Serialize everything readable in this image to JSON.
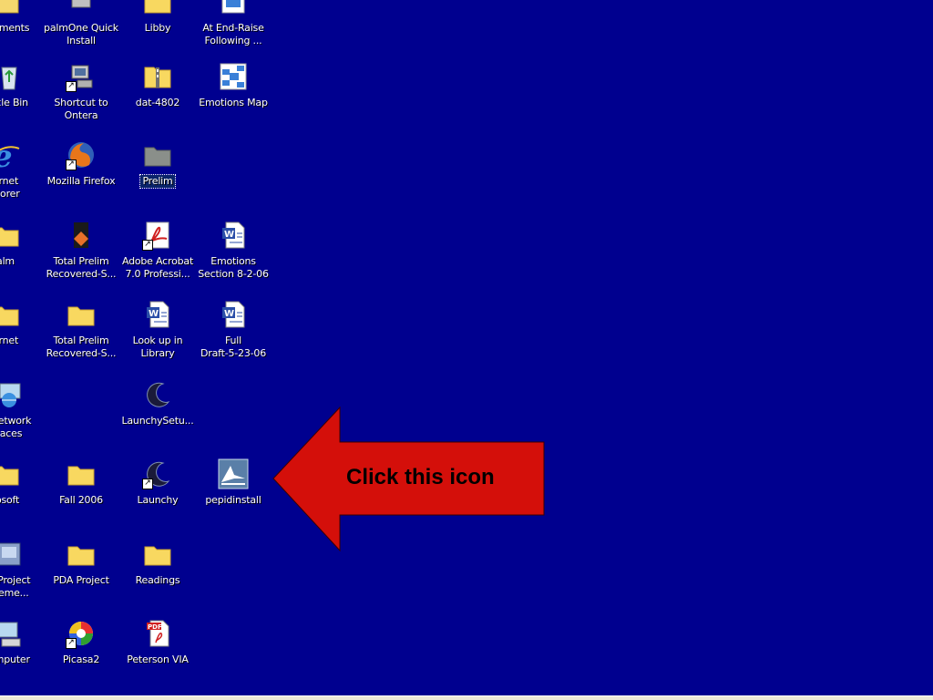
{
  "desktop": {
    "background_color": "#00008f",
    "icons": [
      {
        "id": "my-documents",
        "label": "My Documents",
        "display": "ocuments",
        "icon": "folder-documents-icon"
      },
      {
        "id": "palmone",
        "label": "palmOne Quick Install",
        "display": "palmOne Quick\nInstall",
        "icon": "palm-install-icon"
      },
      {
        "id": "libby",
        "label": "Libby",
        "display": "Libby",
        "icon": "folder-icon"
      },
      {
        "id": "end-raise",
        "label": "At End-Raise Following ...",
        "display": "At End-Raise\nFollowing ...",
        "icon": "mindmap-icon"
      },
      {
        "id": "recycle-bin",
        "label": "Recycle Bin",
        "display": "ycle Bin",
        "icon": "recycle-bin-icon"
      },
      {
        "id": "shortcut-ontera",
        "label": "Shortcut to Ontera",
        "display": "Shortcut to\nOntera",
        "icon": "network-computer-icon"
      },
      {
        "id": "dat-4802",
        "label": "dat-4802",
        "display": "dat-4802",
        "icon": "zip-folder-icon"
      },
      {
        "id": "emotions-map",
        "label": "Emotions Map",
        "display": "Emotions Map",
        "icon": "mindmap-icon"
      },
      {
        "id": "internet-explorer",
        "label": "Internet Explorer",
        "display": "ernet\nplorer",
        "icon": "internet-explorer-icon"
      },
      {
        "id": "firefox",
        "label": "Mozilla Firefox",
        "display": "Mozilla Firefox",
        "icon": "firefox-icon"
      },
      {
        "id": "prelim",
        "label": "Prelim",
        "display": "Prelim",
        "icon": "folder-grey-icon",
        "selected": true
      },
      {
        "id": "palm",
        "label": "Palm",
        "display": "alm",
        "icon": "folder-icon"
      },
      {
        "id": "total-prelim-1",
        "label": "Total Prelim Recovered-S...",
        "display": "Total Prelim\nRecovered-S...",
        "icon": "document-orange-icon"
      },
      {
        "id": "acrobat",
        "label": "Adobe Acrobat 7.0 Professi...",
        "display": "Adobe Acrobat\n7.0 Professi...",
        "icon": "acrobat-icon"
      },
      {
        "id": "emotions-section",
        "label": "Emotions Section 8-2-06",
        "display": "Emotions\nSection 8-2-06",
        "icon": "word-document-icon"
      },
      {
        "id": "internet",
        "label": "Internet",
        "display": "ernet",
        "icon": "folder-icon"
      },
      {
        "id": "total-prelim-2",
        "label": "Total Prelim Recovered-S...",
        "display": "Total Prelim\nRecovered-S...",
        "icon": "folder-icon"
      },
      {
        "id": "look-up-library",
        "label": "Look up in Library",
        "display": "Look up in\nLibrary",
        "icon": "word-document-icon"
      },
      {
        "id": "full-draft",
        "label": "Full Draft-5-23-06",
        "display": "Full\nDraft-5-23-06",
        "icon": "word-document-icon"
      },
      {
        "id": "network-places",
        "label": "Network Places",
        "display": "Network\naces",
        "icon": "network-places-icon"
      },
      {
        "id": "launchy-setup",
        "label": "LaunchySetu...",
        "display": "LaunchySetu...",
        "icon": "launchy-icon"
      },
      {
        "id": "microsoft",
        "label": "Microsoft",
        "display": "rosoft",
        "icon": "folder-icon"
      },
      {
        "id": "fall-2006",
        "label": "Fall 2006",
        "display": "Fall 2006",
        "icon": "folder-icon"
      },
      {
        "id": "launchy",
        "label": "Launchy",
        "display": "Launchy",
        "icon": "launchy-icon"
      },
      {
        "id": "pepidinstall",
        "label": "pepidinstall",
        "display": "pepidinstall",
        "icon": "pepid-install-icon"
      },
      {
        "id": "pda-project-elements",
        "label": "PDA Project Eleme...",
        "display": "A Project\nEleme...",
        "icon": "pda-app-icon"
      },
      {
        "id": "pda-project",
        "label": "PDA Project",
        "display": "PDA Project",
        "icon": "folder-icon"
      },
      {
        "id": "readings",
        "label": "Readings",
        "display": "Readings",
        "icon": "folder-icon"
      },
      {
        "id": "my-computer",
        "label": "My Computer",
        "display": "omputer",
        "icon": "my-computer-icon"
      },
      {
        "id": "picasa2",
        "label": "Picasa2",
        "display": "Picasa2",
        "icon": "picasa-icon"
      },
      {
        "id": "peterson-via",
        "label": "Peterson VIA",
        "display": "Peterson VIA",
        "icon": "pdf-icon"
      }
    ]
  },
  "callout": {
    "text": "Click this icon",
    "color": "#d40f0a"
  }
}
